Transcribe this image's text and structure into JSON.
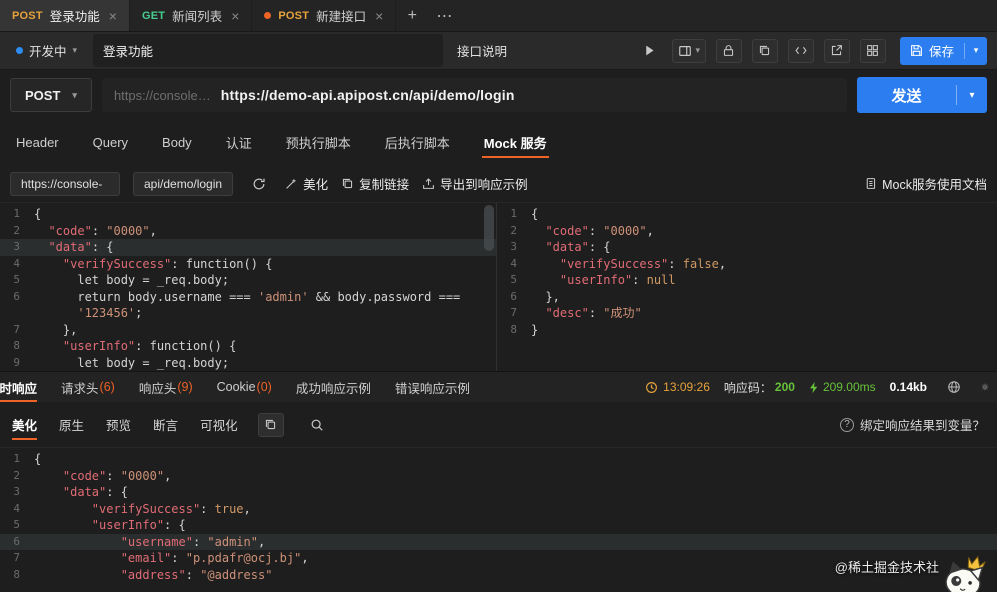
{
  "colors": {
    "accent": "#ee6326",
    "post": "#e6a23c",
    "get": "#49cc90",
    "success": "#67c23a",
    "time": "#e6a23c",
    "blue": "#2b7df0"
  },
  "tabbar": {
    "add_label": "+",
    "more_label": "⋯",
    "close_label": "×",
    "tabs": [
      {
        "method": "POST",
        "label": "登录功能",
        "active": true,
        "dirty": false
      },
      {
        "method": "GET",
        "label": "新闻列表",
        "active": false,
        "dirty": false
      },
      {
        "method": "POST",
        "label": "新建接口",
        "active": false,
        "dirty": true
      }
    ]
  },
  "header": {
    "status_label": "开发中",
    "api_name": "登录功能",
    "doc_link": "接口说明",
    "save_label": "保存"
  },
  "request": {
    "method": "POST",
    "url_prefix": "https://console…",
    "url": "https://demo-api.apipost.cn/api/demo/login",
    "send_label": "发送",
    "tabs": [
      {
        "label": "Header"
      },
      {
        "label": "Query"
      },
      {
        "label": "Body"
      },
      {
        "label": "认证"
      },
      {
        "label": "预执行脚本"
      },
      {
        "label": "后执行脚本"
      },
      {
        "label": "Mock 服务",
        "active": true
      }
    ]
  },
  "mock": {
    "base_url": "https://console-",
    "path": "api/demo/login",
    "beautify_label": "美化",
    "copy_link_label": "复制链接",
    "export_label": "导出到响应示例",
    "docs_label": "Mock服务使用文档"
  },
  "mock_editor": {
    "rows": [
      {
        "n": "1",
        "s": [
          [
            "p",
            "{"
          ]
        ]
      },
      {
        "n": "2",
        "s": [
          [
            "p",
            "  "
          ],
          [
            "k",
            "\"code\""
          ],
          [
            "p",
            ": "
          ],
          [
            "s",
            "\"0000\""
          ],
          [
            "p",
            ","
          ]
        ]
      },
      {
        "n": "3",
        "h": true,
        "s": [
          [
            "p",
            "  "
          ],
          [
            "k",
            "\"data\""
          ],
          [
            "p",
            ": {"
          ]
        ]
      },
      {
        "n": "4",
        "s": [
          [
            "p",
            "    "
          ],
          [
            "k",
            "\"verifySuccess\""
          ],
          [
            "p",
            ": function() {"
          ]
        ]
      },
      {
        "n": "5",
        "s": [
          [
            "p",
            "      let body = _req.body;"
          ]
        ]
      },
      {
        "n": "6",
        "s": [
          [
            "p",
            "      return body.username === "
          ],
          [
            "s",
            "'admin'"
          ],
          [
            "p",
            " && body.password ==="
          ]
        ]
      },
      {
        "n": "",
        "s": [
          [
            "p",
            "      "
          ],
          [
            "s",
            "'123456'"
          ],
          [
            "p",
            ";"
          ]
        ]
      },
      {
        "n": "7",
        "s": [
          [
            "p",
            "    },"
          ]
        ]
      },
      {
        "n": "8",
        "s": [
          [
            "p",
            "    "
          ],
          [
            "k",
            "\"userInfo\""
          ],
          [
            "p",
            ": function() {"
          ]
        ]
      },
      {
        "n": "9",
        "s": [
          [
            "p",
            "      let body = _req.body;"
          ]
        ]
      }
    ]
  },
  "mock_preview": {
    "rows": [
      {
        "n": "1",
        "s": [
          [
            "p",
            "{"
          ]
        ]
      },
      {
        "n": "2",
        "s": [
          [
            "p",
            "  "
          ],
          [
            "k",
            "\"code\""
          ],
          [
            "p",
            ": "
          ],
          [
            "s",
            "\"0000\""
          ],
          [
            "p",
            ","
          ]
        ]
      },
      {
        "n": "3",
        "s": [
          [
            "p",
            "  "
          ],
          [
            "k",
            "\"data\""
          ],
          [
            "p",
            ": {"
          ]
        ]
      },
      {
        "n": "4",
        "s": [
          [
            "p",
            "    "
          ],
          [
            "k",
            "\"verifySuccess\""
          ],
          [
            "p",
            ": "
          ],
          [
            "b",
            "false"
          ],
          [
            "p",
            ","
          ]
        ]
      },
      {
        "n": "5",
        "s": [
          [
            "p",
            "    "
          ],
          [
            "k",
            "\"userInfo\""
          ],
          [
            "p",
            ": "
          ],
          [
            "b",
            "null"
          ]
        ]
      },
      {
        "n": "6",
        "s": [
          [
            "p",
            "  },"
          ]
        ]
      },
      {
        "n": "7",
        "s": [
          [
            "p",
            "  "
          ],
          [
            "k",
            "\"desc\""
          ],
          [
            "p",
            ": "
          ],
          [
            "s",
            "\"成功\""
          ]
        ]
      },
      {
        "n": "8",
        "s": [
          [
            "p",
            "}"
          ]
        ]
      }
    ]
  },
  "response": {
    "tabs": [
      {
        "label": "实时响应",
        "active": true
      },
      {
        "label": "请求头",
        "count": "(6)"
      },
      {
        "label": "响应头",
        "count": "(9)"
      },
      {
        "label": "Cookie",
        "count": "(0)"
      },
      {
        "label": "成功响应示例"
      },
      {
        "label": "错误响应示例"
      }
    ],
    "time": "13:09:26",
    "status_label": "响应码：",
    "status_code": "200",
    "duration": "209.00ms",
    "size": "0.14kb",
    "toolbar": [
      {
        "label": "美化",
        "active": true
      },
      {
        "label": "原生"
      },
      {
        "label": "预览"
      },
      {
        "label": "断言"
      },
      {
        "label": "可视化"
      }
    ],
    "bind_hint": "绑定响应结果到变量？"
  },
  "response_editor": {
    "rows": [
      {
        "n": "1",
        "s": [
          [
            "p",
            "{"
          ]
        ]
      },
      {
        "n": "2",
        "s": [
          [
            "p",
            "    "
          ],
          [
            "k",
            "\"code\""
          ],
          [
            "p",
            ": "
          ],
          [
            "s",
            "\"0000\""
          ],
          [
            "p",
            ","
          ]
        ]
      },
      {
        "n": "3",
        "s": [
          [
            "p",
            "    "
          ],
          [
            "k",
            "\"data\""
          ],
          [
            "p",
            ": {"
          ]
        ]
      },
      {
        "n": "4",
        "s": [
          [
            "p",
            "        "
          ],
          [
            "k",
            "\"verifySuccess\""
          ],
          [
            "p",
            ": "
          ],
          [
            "b",
            "true"
          ],
          [
            "p",
            ","
          ]
        ]
      },
      {
        "n": "5",
        "s": [
          [
            "p",
            "        "
          ],
          [
            "k",
            "\"userInfo\""
          ],
          [
            "p",
            ": {"
          ]
        ]
      },
      {
        "n": "6",
        "h": true,
        "s": [
          [
            "p",
            "            "
          ],
          [
            "k",
            "\"username\""
          ],
          [
            "p",
            ": "
          ],
          [
            "s",
            "\"admin\""
          ],
          [
            "p",
            ","
          ]
        ]
      },
      {
        "n": "7",
        "s": [
          [
            "p",
            "            "
          ],
          [
            "k",
            "\"email\""
          ],
          [
            "p",
            ": "
          ],
          [
            "s",
            "\"p.pdafr@ocj.bj\""
          ],
          [
            "p",
            ","
          ]
        ]
      },
      {
        "n": "8",
        "s": [
          [
            "p",
            "            "
          ],
          [
            "k",
            "\"address\""
          ],
          [
            "p",
            ": "
          ],
          [
            "s",
            "\"@address\""
          ]
        ]
      }
    ]
  },
  "watermark": "@稀土掘金技术社"
}
